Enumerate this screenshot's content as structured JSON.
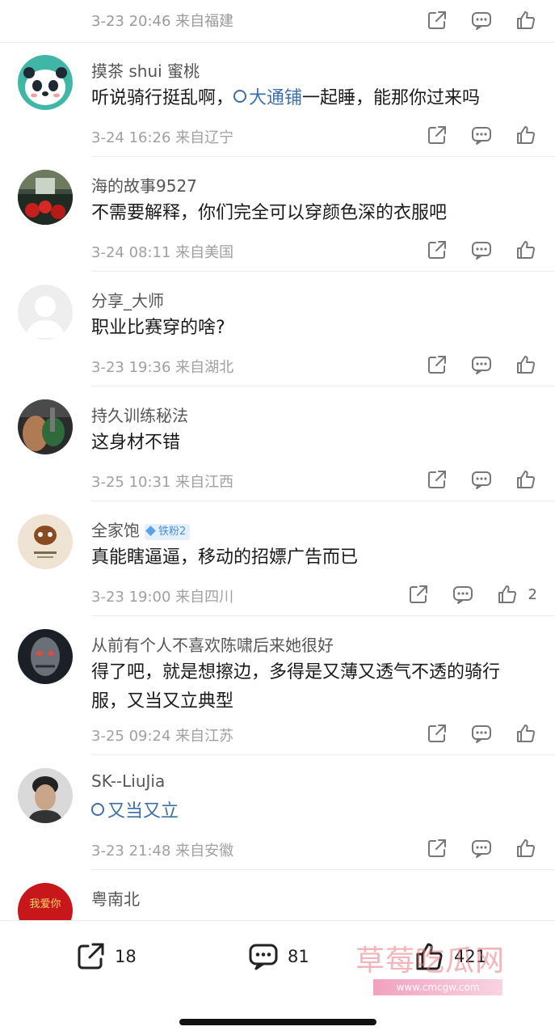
{
  "top_partial": {
    "meta": "3-23 20:46  来自福建"
  },
  "comments": [
    {
      "name": "摸茶 shui 蜜桃",
      "text_before": "听说骑行挺乱啊，",
      "link": "大通铺",
      "text_after": "一起睡，能那你过来吗",
      "meta": "3-24 16:26  来自辽宁"
    },
    {
      "name": "海的故事9527",
      "text": "不需要解释，你们完全可以穿颜色深的衣服吧",
      "meta": "3-24 08:11  来自美国"
    },
    {
      "name": "分享_大师",
      "text": "职业比赛穿的啥?",
      "meta": "3-23 19:36  来自湖北"
    },
    {
      "name": "持久训练秘法",
      "text": "这身材不错",
      "meta": "3-25 10:31  来自江西"
    },
    {
      "name": "全家饱",
      "badge": "铁粉2",
      "text": "真能瞎逼逼，移动的招嫖广告而已",
      "meta": "3-23 19:00  来自四川",
      "likes": "2"
    },
    {
      "name": "从前有个人不喜欢陈啸后来她很好",
      "text_line1": "得了吧，就是想擦边，多得是又薄又透气不透的骑行",
      "text_line2": "服，又当又立典型",
      "meta": "3-25 09:24  来自江苏"
    },
    {
      "name": "SK--LiuJia",
      "link": "又当又立",
      "meta": "3-23 21:48  来自安徽"
    },
    {
      "name": "粤南北",
      "avatar_text": "我爱你"
    }
  ],
  "bottom_bar": {
    "share_count": "18",
    "comment_count": "81",
    "like_count": "421"
  },
  "watermark": {
    "text": "草莓吃瓜网",
    "url": "www.cmcgw.com"
  },
  "colors": {
    "accent_link": "#3e6ea8",
    "meta_gray": "#a0a0a0",
    "badge_blue": "#4a8fd8"
  }
}
